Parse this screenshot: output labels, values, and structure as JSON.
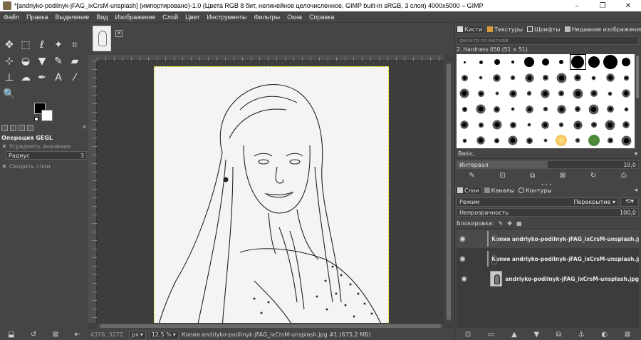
{
  "window": {
    "title": "*[andriyko-podilnyk-jFAG_ixCrsM-unsplash] (импортировано)-1.0 (Цвета RGB 8 бит, нелинейное целочисленное, GIMP built-in sRGB, 3 слоя) 4000x5000 – GIMP",
    "minimize": "–",
    "maximize": "❐",
    "close": "✕"
  },
  "menu": [
    "Файл",
    "Правка",
    "Выделение",
    "Вид",
    "Изображение",
    "Слой",
    "Цвет",
    "Инструменты",
    "Фильтры",
    "Окна",
    "Справка"
  ],
  "tools": [
    {
      "name": "move-tool-icon",
      "glyph": "✥"
    },
    {
      "name": "rect-select-icon",
      "glyph": "⬚"
    },
    {
      "name": "lasso-icon",
      "glyph": "ℓ"
    },
    {
      "name": "fuzzy-select-icon",
      "glyph": "✦"
    },
    {
      "name": "crop-icon",
      "glyph": "⌗"
    },
    {
      "name": "unified-transform-icon",
      "glyph": "⊹"
    },
    {
      "name": "warp-icon",
      "glyph": "◒"
    },
    {
      "name": "fill-icon",
      "glyph": "▼"
    },
    {
      "name": "paintbrush-icon",
      "glyph": "✎"
    },
    {
      "name": "eraser-icon",
      "glyph": "▰"
    },
    {
      "name": "clone-icon",
      "glyph": "⊥"
    },
    {
      "name": "smudge-icon",
      "glyph": "☁"
    },
    {
      "name": "paths-icon",
      "glyph": "✒"
    },
    {
      "name": "text-icon",
      "glyph": "A"
    },
    {
      "name": "color-picker-icon",
      "glyph": "⁄"
    },
    {
      "name": "zoom-icon",
      "glyph": "🔍"
    }
  ],
  "tool_options": {
    "title": "Операция GEGL",
    "average_label": "Усреднять значение",
    "radius_label": "Радиус",
    "radius_value": "3",
    "merge_label": "Сводить слои"
  },
  "status": {
    "coords": "4376, 3272",
    "unit": "px",
    "zoom": "12.5 %",
    "message": "Копия andriyko-podilnyk-jFAG_ixCrsM-unsplash.jpg #1 (675,2 МБ)"
  },
  "brushes_dock": {
    "tabs": [
      "Кисти",
      "Текстуры",
      "Шрифты",
      "Недавние изображения"
    ],
    "filter_placeholder": "фильтр по меткам",
    "brush_name": "2. Hardness 050 (51 × 51)",
    "preset": "Basic,",
    "interval_label": "Интервал",
    "interval_value": "10,0",
    "interval_fraction": 0.5
  },
  "layers_dock": {
    "tabs": [
      "Слои",
      "Каналы",
      "Контуры"
    ],
    "mode_label": "Режим",
    "mode_value": "Перекрытие",
    "opacity_label": "Непрозрачность",
    "opacity_value": "100,0",
    "lock_label": "Блокировка:",
    "layers": [
      {
        "name": "Копия andriyko-podilnyk-jFAG_ixCrsM-unsplash.jpg",
        "active": true
      },
      {
        "name": "Копия andriyko-podilnyk-jFAG_ixCrsM-unsplash.jpg",
        "active": false
      },
      {
        "name": "andriyko-podilnyk-jFAG_ixCrsM-unsplash.jpg",
        "active": false
      }
    ]
  },
  "colors": {
    "ui_bg": "#454545",
    "canvas_bg": "#3d3d3d",
    "selection_border": "#e3e000",
    "brushes_bg": "#ffffff"
  }
}
